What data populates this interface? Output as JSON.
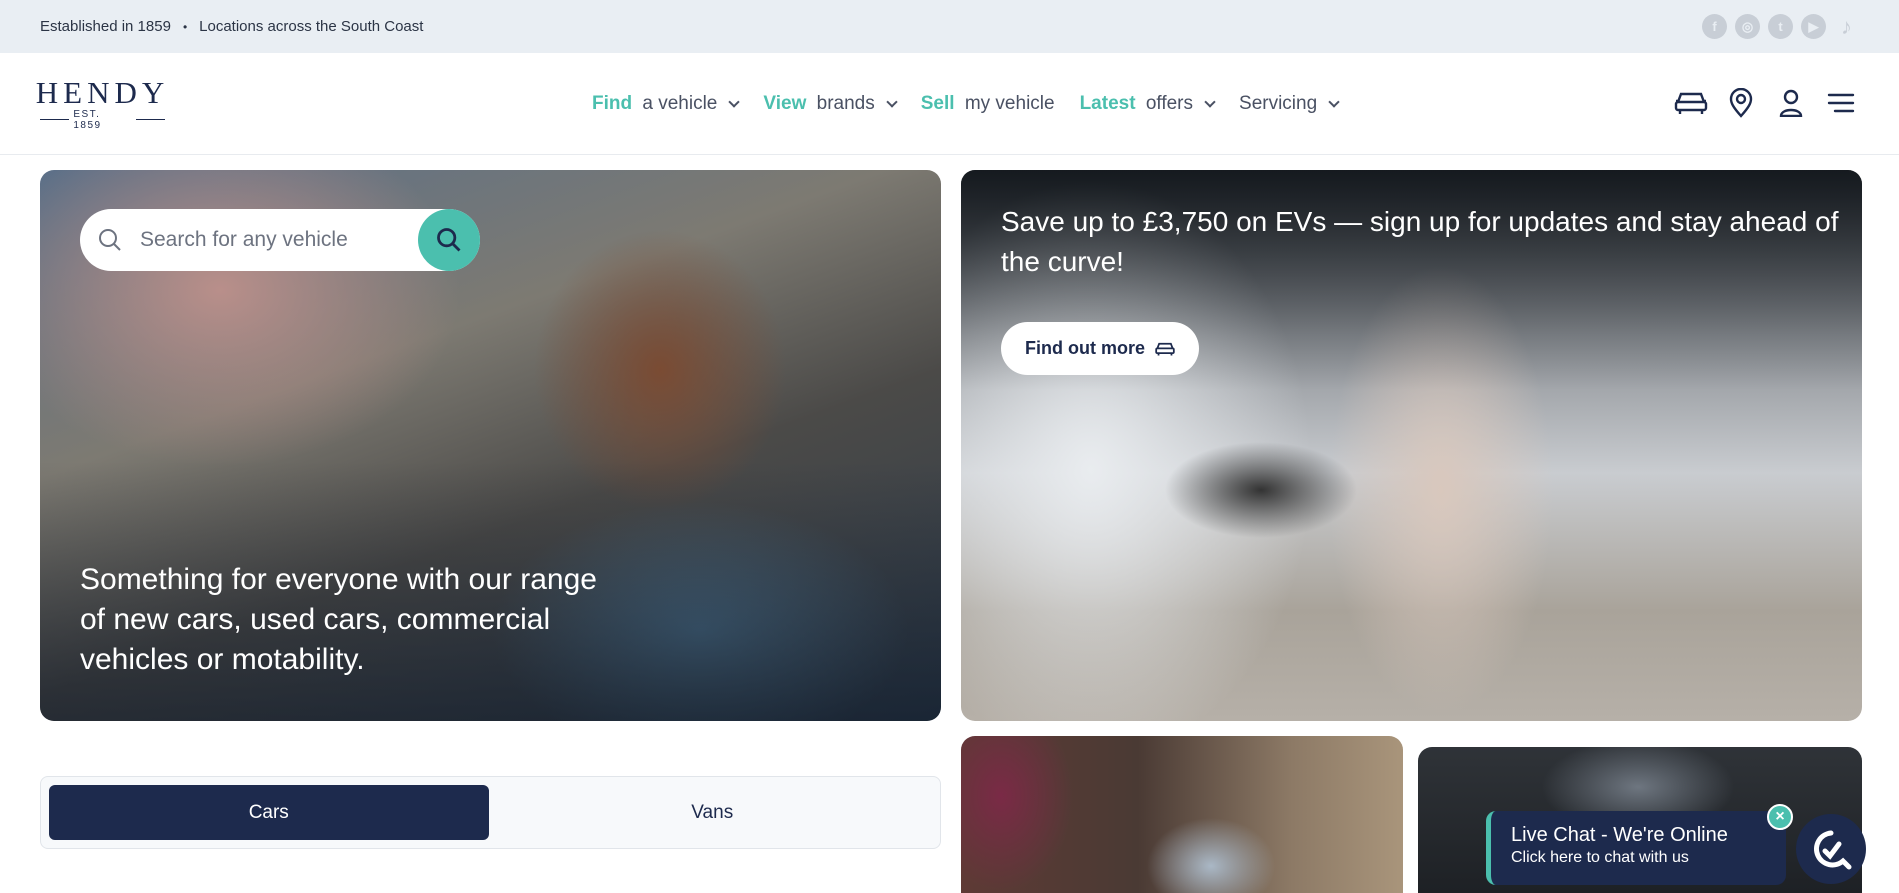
{
  "topbar": {
    "established": "Established in 1859",
    "locations": "Locations across the South Coast",
    "social_icons": [
      "facebook-icon",
      "instagram-icon",
      "twitter-icon",
      "youtube-icon",
      "tiktok-icon"
    ]
  },
  "header": {
    "logo_word": "HENDY",
    "logo_est": "EST. 1859",
    "nav": [
      {
        "highlight": "Find",
        "rest": " a vehicle",
        "dropdown": true
      },
      {
        "highlight": "View",
        "rest": " brands",
        "dropdown": true
      },
      {
        "highlight": "Sell",
        "rest": " my vehicle",
        "dropdown": false
      },
      {
        "highlight": "Latest",
        "rest": " offers",
        "dropdown": true
      },
      {
        "highlight": "",
        "rest": "Servicing",
        "dropdown": true
      }
    ],
    "icons": [
      "car-icon",
      "location-pin-icon",
      "user-icon",
      "menu-icon"
    ]
  },
  "hero_left": {
    "search_placeholder": "Search for any vehicle",
    "headline": "Something for everyone with our range of new cars, used cars, commercial vehicles or motability."
  },
  "hero_right": {
    "headline": "Save up to £3,750 on EVs — sign up for updates and stay ahead of the curve!",
    "cta_label": "Find out more"
  },
  "tabs": {
    "items": [
      "Cars",
      "Vans"
    ],
    "active": "Cars"
  },
  "live_chat": {
    "title": "Live Chat - We're Online",
    "subtitle": "Click here to chat with us"
  },
  "colors": {
    "navy": "#1d2a4d",
    "teal": "#4bbfae",
    "topbar_bg": "#e9eef3"
  }
}
